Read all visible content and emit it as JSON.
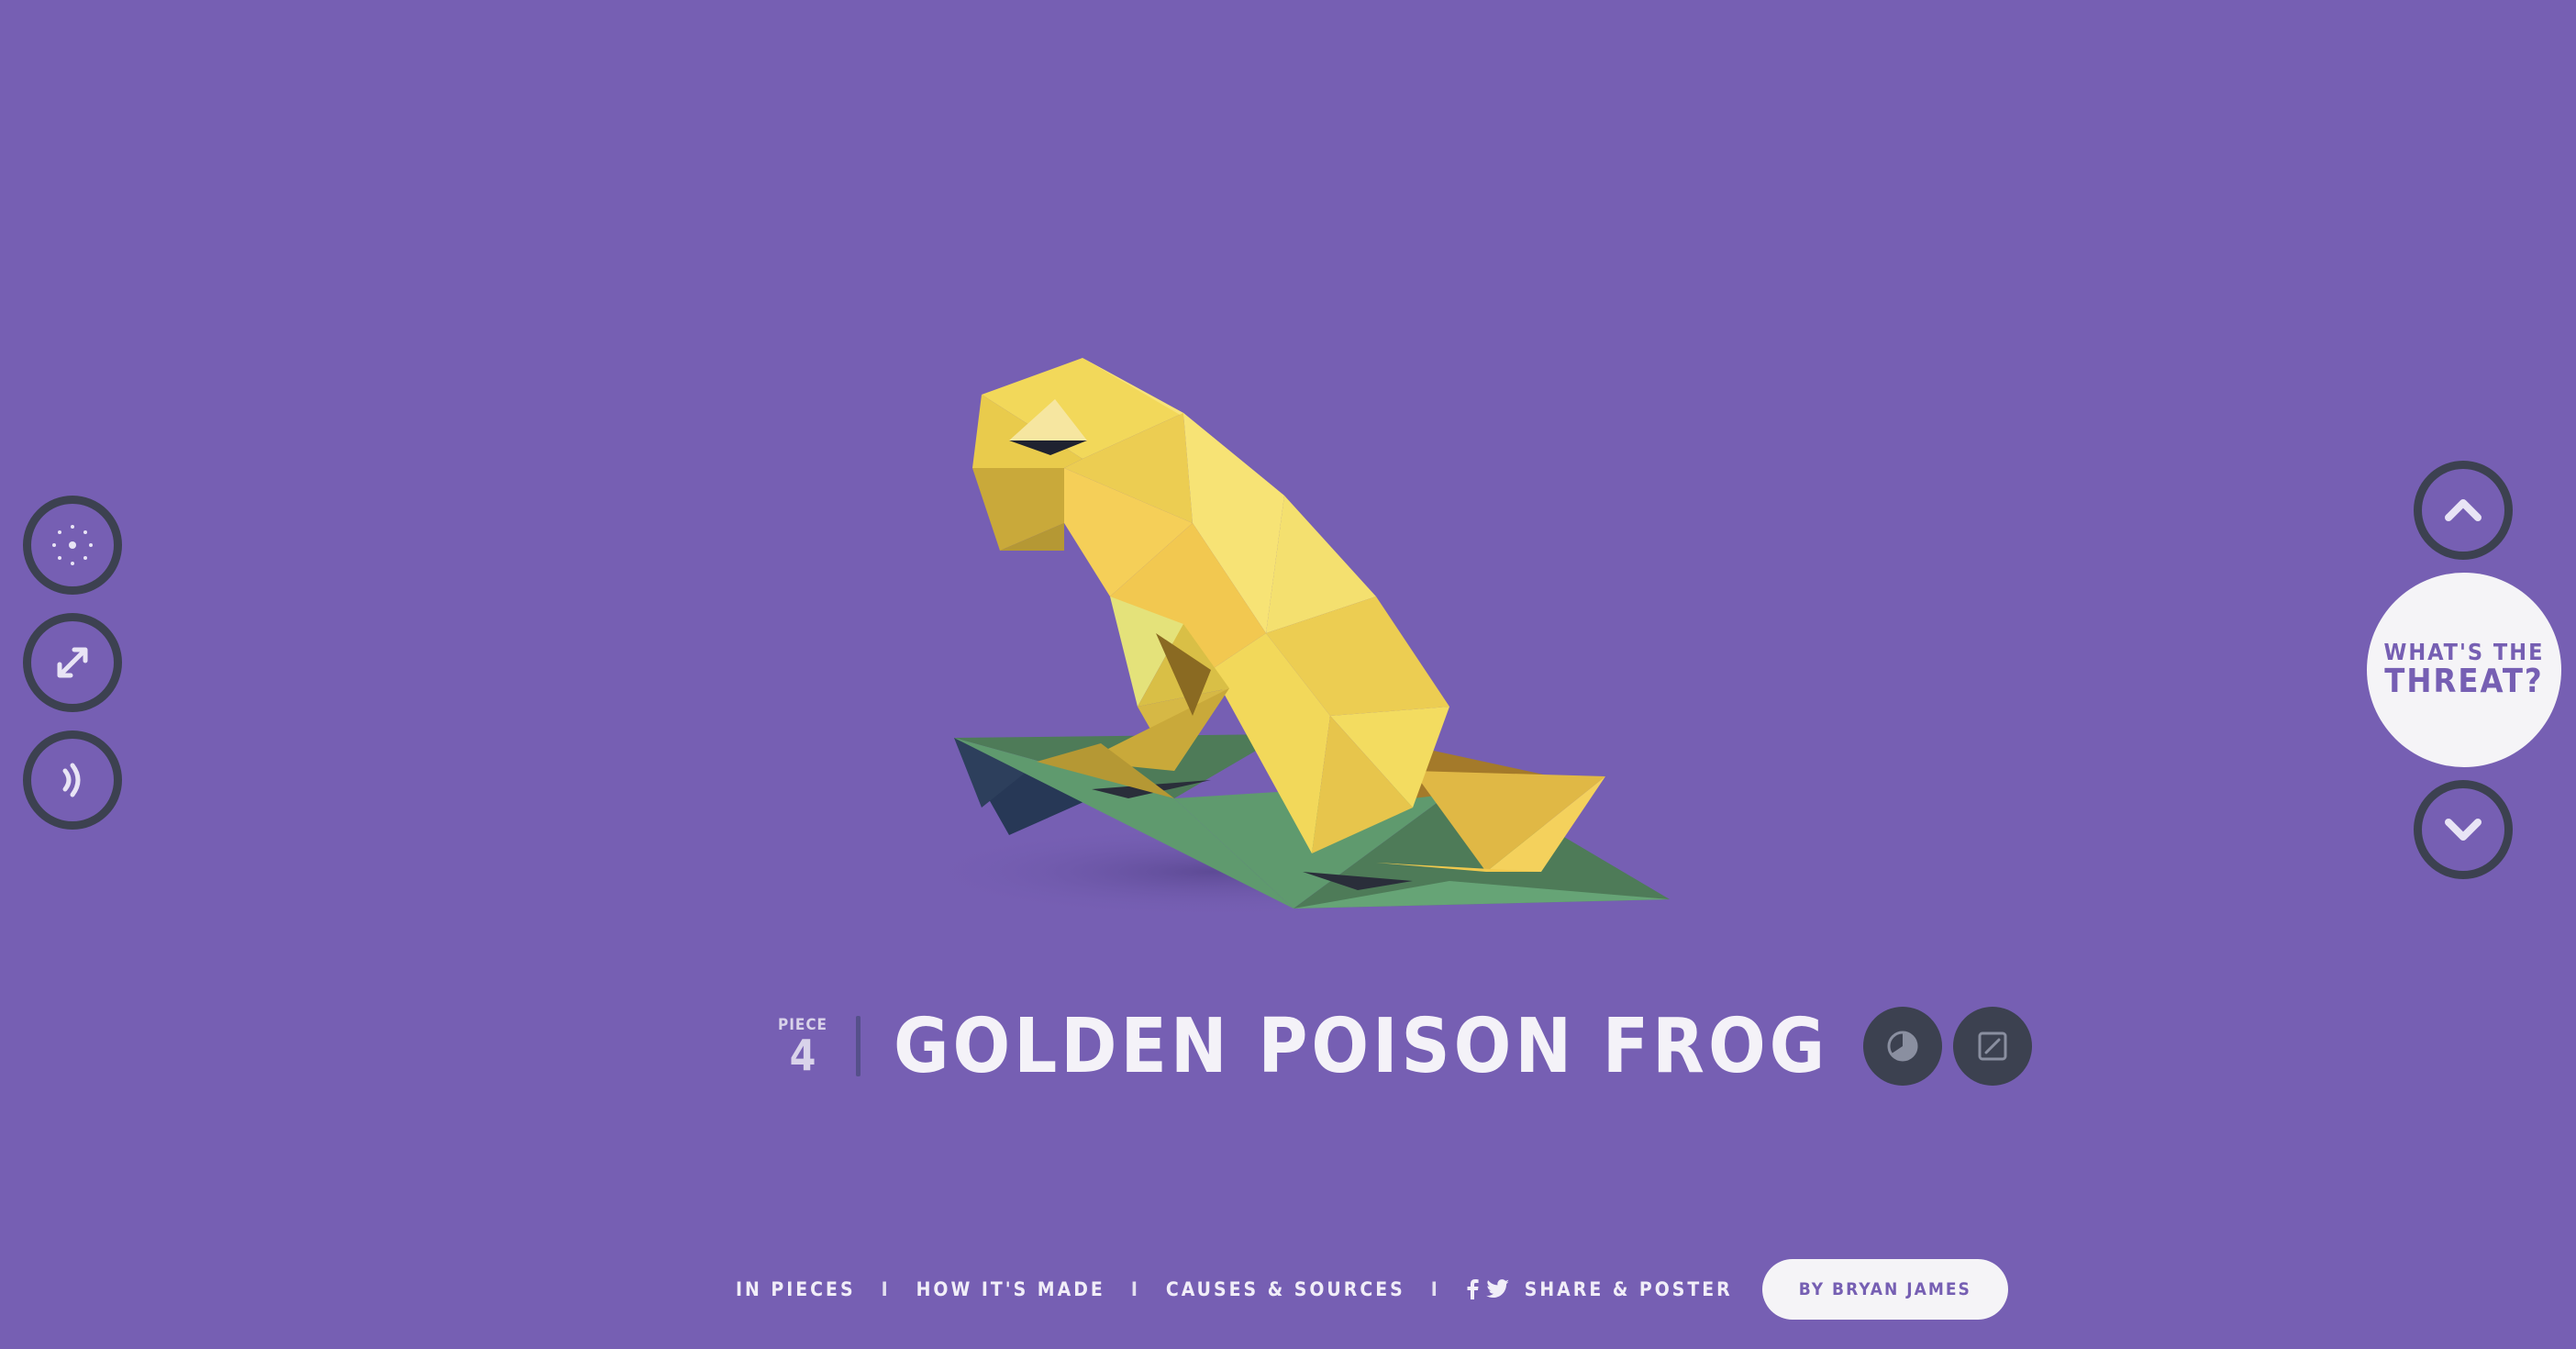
{
  "piece": {
    "label": "PIECE",
    "number": "4",
    "title": "GOLDEN POISON FROG"
  },
  "threat_button": {
    "line1": "WHAT'S THE",
    "line2": "THREAT?"
  },
  "left_controls": [
    {
      "icon": "dots-icon"
    },
    {
      "icon": "shuffle-icon"
    },
    {
      "icon": "sound-icon"
    }
  ],
  "right_controls": [
    {
      "icon": "chevron-up-icon"
    },
    {
      "icon": "chevron-down-icon"
    }
  ],
  "title_actions": [
    {
      "icon": "pie-icon"
    },
    {
      "icon": "edit-icon"
    }
  ],
  "bottom_nav": {
    "in_pieces": "IN PIECES",
    "how_made": "HOW IT'S MADE",
    "causes": "CAUSES & SOURCES",
    "share": "SHARE & POSTER",
    "separator": "I",
    "author": "BY BRYAN JAMES"
  },
  "colors": {
    "background": "#765fb3",
    "button_dark": "#3c4150",
    "frog_yellow": "#f2d85a",
    "leaf_green": "#5f9a6e"
  }
}
